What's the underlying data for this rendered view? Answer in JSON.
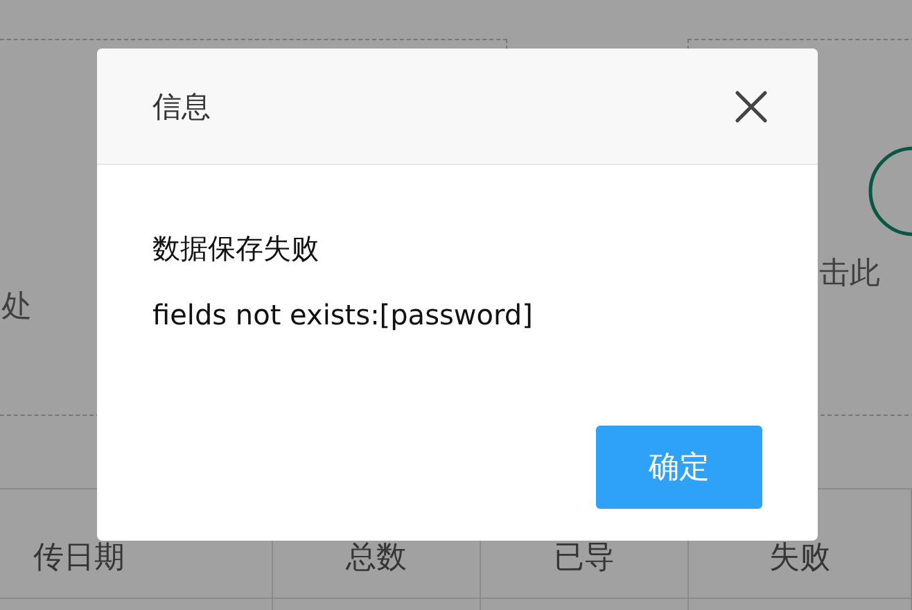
{
  "background": {
    "upload_areas": [
      {
        "hint": "处",
        "icon": false
      },
      {
        "hint": "击此",
        "icon": true
      }
    ],
    "table": {
      "columns": [
        "传日期",
        "总数",
        "已导",
        "失败"
      ]
    }
  },
  "dialog": {
    "title": "信息",
    "message": "数据保存失败",
    "detail": "fields not exists:[password]",
    "buttons": [
      {
        "label": "确定",
        "kind": "primary"
      }
    ]
  }
}
